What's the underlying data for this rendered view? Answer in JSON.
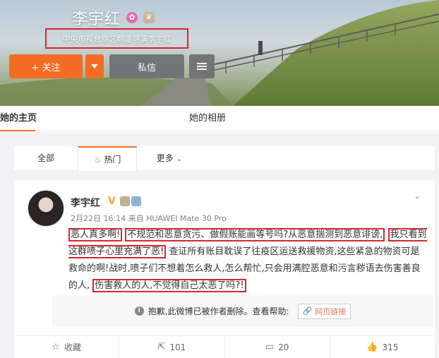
{
  "profile": {
    "name": "李宇红",
    "bio": "中央电视台综艺频道导演李宇红",
    "badges": [
      "verified-pink-icon",
      "member-crown-icon"
    ]
  },
  "buttons": {
    "follow": "+ 关注",
    "message": "私信"
  },
  "nav": {
    "home": "她的主页",
    "album": "她的相册"
  },
  "filters": {
    "all": "全部",
    "hot": "热门",
    "more": "更多"
  },
  "post": {
    "author": "李宇红",
    "verified_mark": "V",
    "time": "2月22日 16:14",
    "source_prefix": "来自",
    "source": "HUAWEI Mate 30 Pro",
    "segments": [
      "恶人真多啊!",
      "不规范和恶意贪污、做假账能画等号吗?从恶意揣测到恶意诽谤,",
      "我只看到这群喷子心里充满了恶!",
      "查证所有账目耽误了往疫区运送救援物资,这些紧急的物资可是救命的啊!战时,喷子们不想着怎么救人,怎么帮忙,只会用满腔恶意和污言秽语去伤害善良的人,",
      "伤害救人的人,不觉得自己太恶了吗?!"
    ],
    "notice": "抱歉,此微博已被作者删除。查看帮助:",
    "notice_link": "网页链接"
  },
  "actions": {
    "favorite": "收藏",
    "repost": "101",
    "comment": "20",
    "like": "315"
  },
  "colors": {
    "accent": "#f26d23",
    "highlight_box": "#d9262b",
    "link": "#eb7350"
  }
}
